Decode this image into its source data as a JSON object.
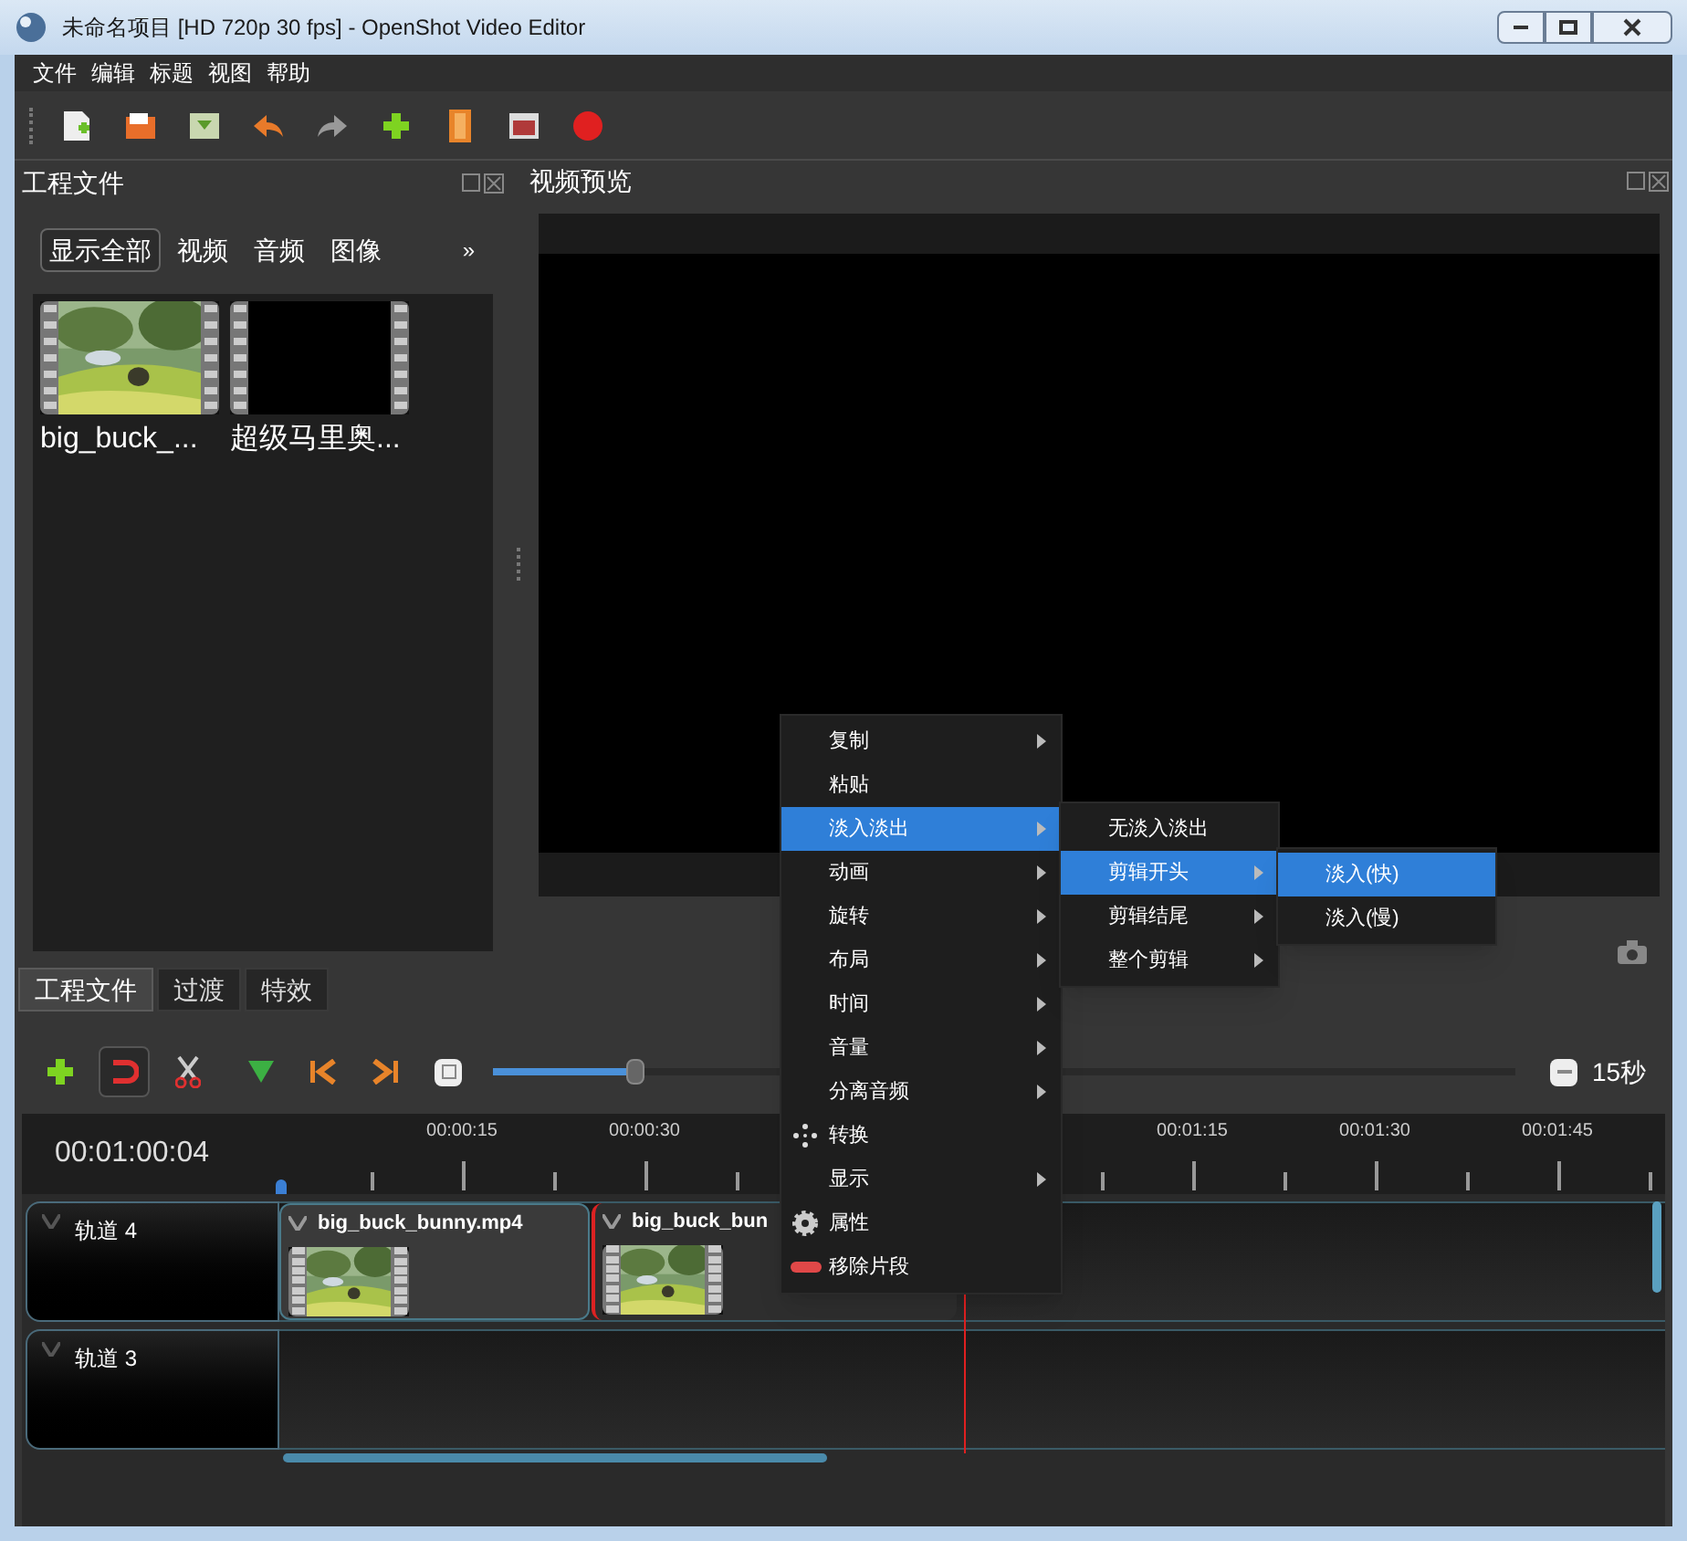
{
  "window": {
    "title": "未命名项目 [HD 720p 30 fps] - OpenShot Video Editor"
  },
  "menu_bar": [
    "文件",
    "编辑",
    "标题",
    "视图",
    "帮助"
  ],
  "project_panel": {
    "title": "工程文件",
    "filters": [
      {
        "label": "显示全部",
        "selected": true
      },
      {
        "label": "视频",
        "selected": false
      },
      {
        "label": "音频",
        "selected": false
      },
      {
        "label": "图像",
        "selected": false
      }
    ],
    "more": "»",
    "files": [
      {
        "name": "big_buck_...",
        "kind": "picture"
      },
      {
        "name": "超级马里奥...",
        "kind": "dark"
      }
    ]
  },
  "preview_panel": {
    "title": "视频预览"
  },
  "dock_tabs": [
    {
      "label": "工程文件",
      "selected": true
    },
    {
      "label": "过渡",
      "selected": false
    },
    {
      "label": "特效",
      "selected": false
    }
  ],
  "timeline": {
    "zoom": {
      "level": 0.14,
      "reading": "15秒"
    },
    "snapping": {
      "on": true
    },
    "timecode": "00:01:00:04",
    "ruler_labels": [
      "00:00:15",
      "00:00:30",
      "00:01:15",
      "00:01:30",
      "00:01:45"
    ],
    "tracks": [
      {
        "name": "轨道 4",
        "clips": [
          {
            "name": "big_buck_bunny.mp4",
            "selected": false
          },
          {
            "name": "big_buck_bun",
            "selected": true
          }
        ]
      },
      {
        "name": "轨道 3"
      }
    ]
  },
  "context_menu": {
    "items": [
      {
        "label": "复制",
        "kind": "submenu",
        "selected": false
      },
      {
        "label": "粘贴",
        "kind": "action",
        "selected": false
      },
      {
        "label": "淡入淡出",
        "kind": "submenu",
        "selected": true
      },
      {
        "label": "动画",
        "kind": "submenu",
        "selected": false
      },
      {
        "label": "旋转",
        "kind": "submenu",
        "selected": false
      },
      {
        "label": "布局",
        "kind": "submenu",
        "selected": false
      },
      {
        "label": "时间",
        "kind": "submenu",
        "selected": false
      },
      {
        "label": "音量",
        "kind": "submenu",
        "selected": false
      },
      {
        "label": "分离音频",
        "kind": "submenu",
        "selected": false
      },
      {
        "label": "转换",
        "kind": "move",
        "selected": false
      },
      {
        "label": "显示",
        "kind": "submenu",
        "selected": false
      },
      {
        "label": "属性",
        "kind": "gear",
        "selected": false
      },
      {
        "label": "移除片段",
        "kind": "remove",
        "selected": false
      }
    ],
    "submenu": [
      {
        "label": "无淡入淡出",
        "kind": "action",
        "selected": false
      },
      {
        "label": "剪辑开头",
        "kind": "submenu",
        "selected": true
      },
      {
        "label": "剪辑结尾",
        "kind": "submenu",
        "selected": false
      },
      {
        "label": "整个剪辑",
        "kind": "submenu",
        "selected": false
      }
    ],
    "submenu_2": [
      {
        "label": "淡入(快)",
        "selected": true
      },
      {
        "label": "淡入(慢)",
        "selected": false
      }
    ]
  }
}
